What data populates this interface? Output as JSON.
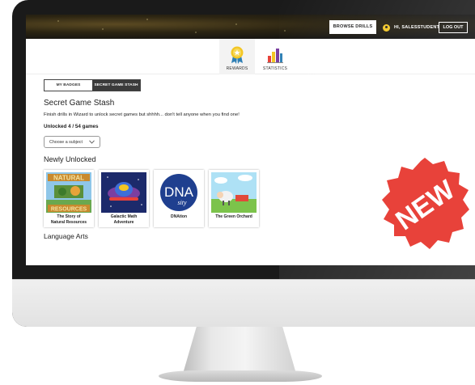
{
  "header": {
    "browse_drills_label": "BROWSE DRILLS",
    "greeting": "HI, SALESSTUDENT",
    "logout_label": "LOG OUT"
  },
  "nav": {
    "tabs": [
      {
        "label": "REWARDS",
        "icon": "award-ribbon-icon",
        "active": true
      },
      {
        "label": "STATISTICS",
        "icon": "bar-chart-icon",
        "active": false
      }
    ]
  },
  "stash": {
    "toggle": {
      "my_badges": "MY BADGES",
      "secret_stash": "SECRET GAME STASH",
      "selected": "secret_stash"
    },
    "title": "Secret Game Stash",
    "description": "Finish drills in Wizard to unlock secret games but shhhh... don't tell anyone when you find one!",
    "unlocked_text": "Unlocked 4 / 54 games",
    "subject_select": {
      "placeholder": "Choose a subject"
    },
    "newly_unlocked_heading": "Newly Unlocked",
    "games": [
      {
        "title_line1": "The Story of",
        "title_line2": "Natural Resources"
      },
      {
        "title_line1": "Galactic Math",
        "title_line2": "Adventure"
      },
      {
        "title_line1": "DNAtion",
        "title_line2": ""
      },
      {
        "title_line1": "The Green Orchard",
        "title_line2": ""
      }
    ],
    "thumb_text": {
      "natural_top": "NATURAL",
      "natural_bottom": "RESOURCES",
      "dna_main": "DNA",
      "dna_sub": "sity"
    },
    "category_heading": "Language Arts"
  },
  "badge": {
    "text": "NEW",
    "color": "#e8423a"
  },
  "colors": {
    "accent_yellow": "#f3c623",
    "dark": "#3b3b3b"
  }
}
